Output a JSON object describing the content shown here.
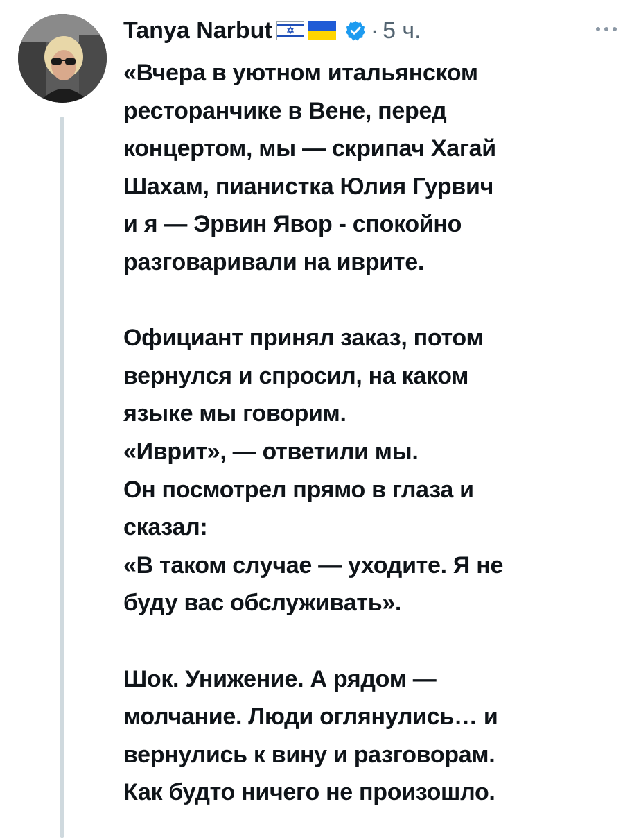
{
  "post": {
    "author_name": "Tanya Narbut",
    "author_flags": [
      "israel-flag-icon",
      "ukraine-flag-icon"
    ],
    "verified": true,
    "separator": "·",
    "time": "5 ч.",
    "lines": [
      "«Вчера в уютном итальянском",
      "ресторанчике в Вене, перед",
      "концертом, мы — скрипач Хагай",
      "Шахам, пианистка Юлия Гурвич",
      "и я — Эрвин Явор - спокойно",
      "разговаривали на иврите.",
      "",
      "Официант принял заказ, потом",
      "вернулся и спросил, на каком",
      "языке мы говорим.",
      "«Иврит», — ответили мы.",
      "Он посмотрел прямо в глаза и",
      "сказал:",
      "«В таком случае — уходите. Я не",
      "буду вас обслуживать».",
      "",
      "Шок. Унижение. А рядом —",
      "молчание. Люди оглянулись… и",
      "вернулись к вину и разговорам.",
      "Как будто ничего не произошло."
    ]
  },
  "colors": {
    "text": "#0f1419",
    "muted": "#536471",
    "verified": "#1d9bf0",
    "thread_line": "#cfd9de"
  }
}
